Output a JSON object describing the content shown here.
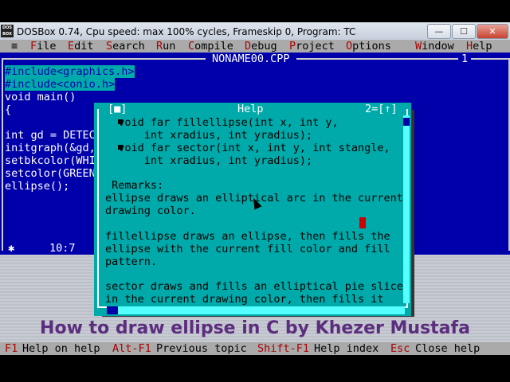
{
  "window": {
    "icon_text": "DOS BOX",
    "title": "DOSBox 0.74, Cpu speed: max 100% cycles, Frameskip  0, Program:    TC",
    "min_glyph": "—",
    "max_glyph": "☐",
    "close_glyph": "✕"
  },
  "menu": {
    "system": "≡",
    "items": [
      {
        "hk": "F",
        "rest": "ile"
      },
      {
        "hk": "E",
        "rest": "dit"
      },
      {
        "hk": "S",
        "rest": "earch"
      },
      {
        "hk": "R",
        "rest": "un"
      },
      {
        "hk": "C",
        "rest": "ompile"
      },
      {
        "hk": "D",
        "rest": "ebug"
      },
      {
        "hk": "P",
        "rest": "roject"
      },
      {
        "hk": "O",
        "rest": "ptions"
      },
      {
        "hk": "W",
        "rest": "indow"
      },
      {
        "hk": "H",
        "rest": "elp"
      }
    ]
  },
  "editor": {
    "filename": "NONAME00.CPP",
    "window_number": "1",
    "lines": [
      "#include<graphics.h>",
      "#include<conio.h>",
      "void main()",
      "{",
      "",
      "int gd = DETEC",
      "initgraph(&gd,",
      "setbkcolor(WHI",
      "setcolor(GREEN",
      "ellipse();"
    ],
    "status_glyph": "✱",
    "position": "10:7"
  },
  "help": {
    "close_box": "[■]",
    "title": "Help",
    "zoom_box": "2=[↑]",
    "lines": [
      "  void far fillellipse(int x, int y,",
      "      int xradius, int yradius);",
      "  void far sector(int x, int y, int stangle,",
      "      int xradius, int yradius);",
      "",
      " Remarks:",
      "ellipse draws an elliptical arc in the current",
      "drawing color.",
      "",
      "fillellipse draws an ellipse, then fills the",
      "ellipse with the current fill color and fill",
      "pattern.",
      "",
      "sector draws and fills an elliptical pie slice",
      "in the current drawing color, then fills it"
    ]
  },
  "caption": "How to draw ellipse in C by Khezer Mustafa",
  "statusbar": [
    {
      "key": "F1",
      "label": "Help on help"
    },
    {
      "key": "Alt-F1",
      "label": "Previous topic"
    },
    {
      "key": "Shift-F1",
      "label": "Help index"
    },
    {
      "key": "Esc",
      "label": "Close help"
    }
  ]
}
